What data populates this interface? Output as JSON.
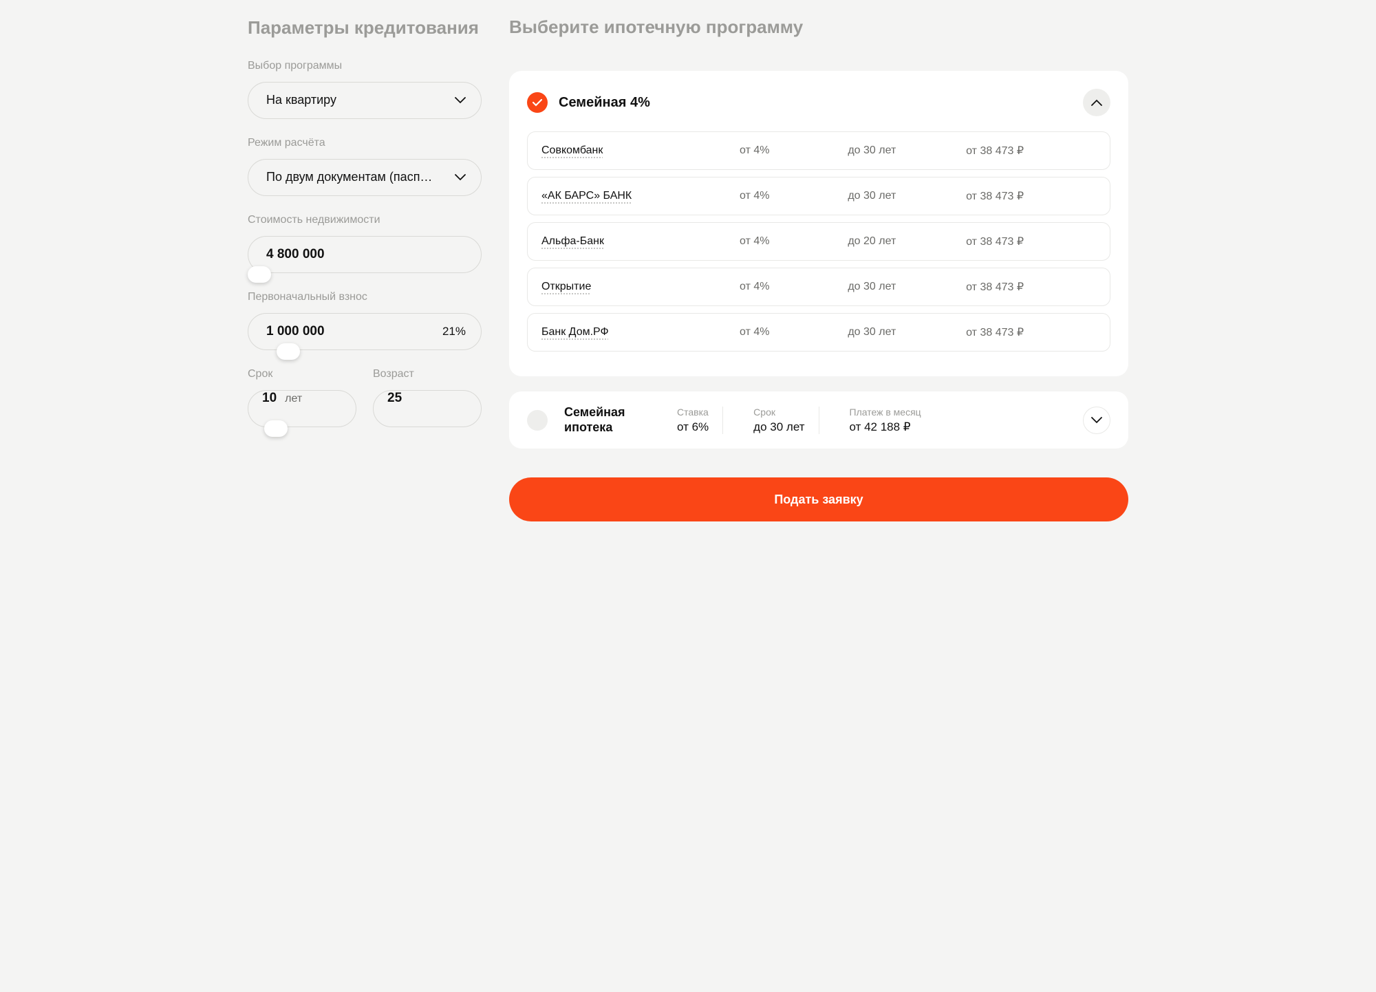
{
  "sidebar": {
    "title": "Параметры кредитования",
    "program_label": "Выбор программы",
    "program_value": "На квартиру",
    "mode_label": "Режим расчёта",
    "mode_value": "По двум документам (пасп…",
    "price_label": "Стоимость недвижимости",
    "price_value": "4 800 000",
    "down_label": "Первоначальный взнос",
    "down_value": "1 000 000",
    "down_pct": "21%",
    "term_label": "Срок",
    "term_value": "10",
    "term_unit": "лет",
    "age_label": "Возраст",
    "age_value": "25"
  },
  "main": {
    "title": "Выберите ипотечную программу",
    "program_a": {
      "title": "Семейная 4%",
      "banks": [
        {
          "name": "Совкомбанк",
          "rate": "от 4%",
          "term": "до 30 лет",
          "payment": "от 38 473 ₽"
        },
        {
          "name": "«АК БАРС» БАНК",
          "rate": "от 4%",
          "term": "до 30 лет",
          "payment": "от 38 473 ₽"
        },
        {
          "name": "Альфа-Банк",
          "rate": "от 4%",
          "term": "до 20 лет",
          "payment": "от 38 473 ₽"
        },
        {
          "name": "Открытие",
          "rate": "от 4%",
          "term": "до 30 лет",
          "payment": "от 38 473 ₽"
        },
        {
          "name": "Банк Дом.РФ",
          "rate": "от 4%",
          "term": "до 30 лет",
          "payment": "от 38 473 ₽"
        }
      ]
    },
    "program_b": {
      "title": "Семейная ипотека",
      "rate_label": "Ставка",
      "rate_value": "от 6%",
      "term_label": "Срок",
      "term_value": "до 30 лет",
      "payment_label": "Платеж в месяц",
      "payment_value": "от 42 188 ₽"
    },
    "submit": "Подать заявку"
  }
}
